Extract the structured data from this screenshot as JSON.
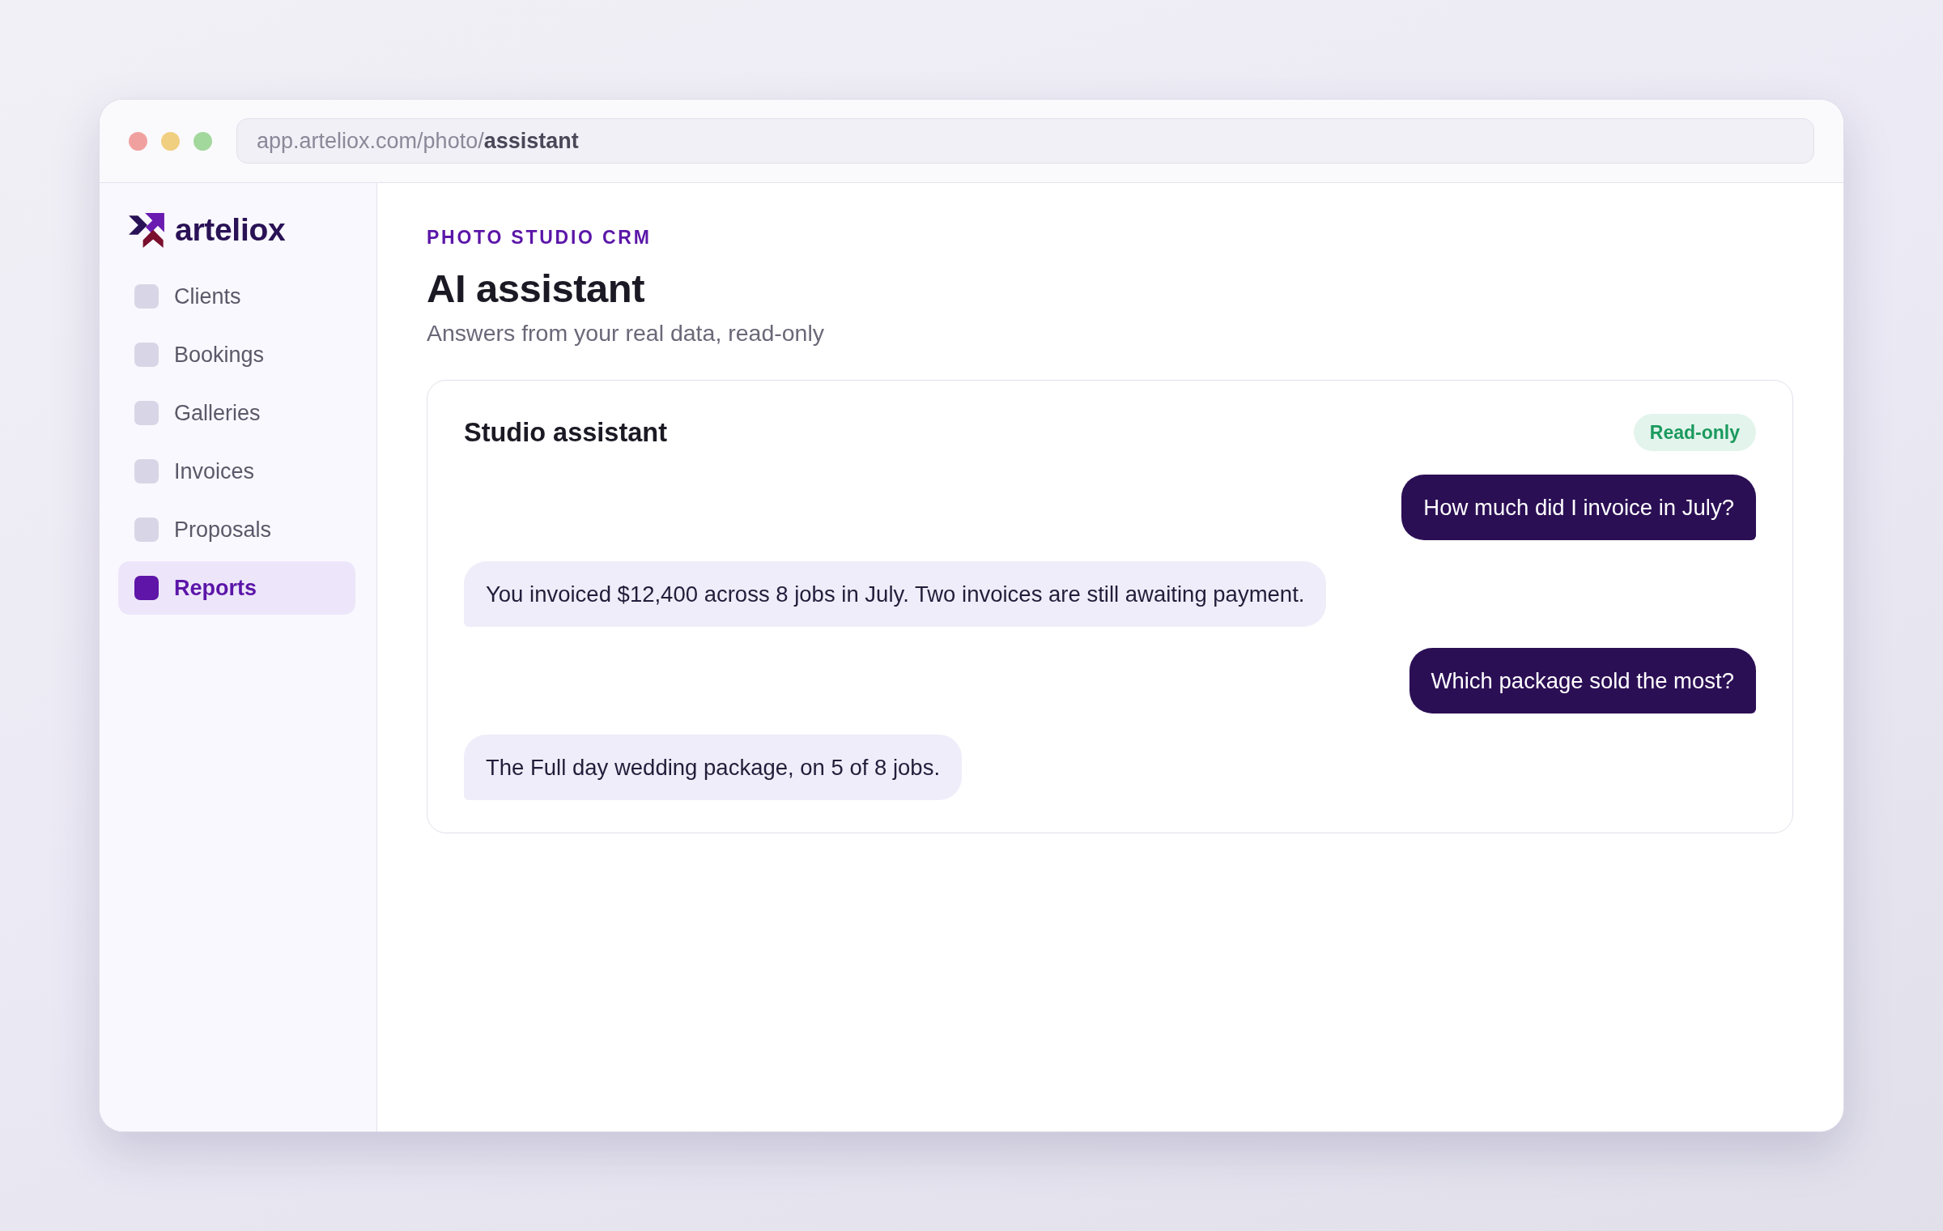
{
  "browser": {
    "url": "app.arteliox.com/photo/**assistant**"
  },
  "sidebar": {
    "brand": "arteliox",
    "items": [
      {
        "label": "Clients",
        "selected": false
      },
      {
        "label": "Bookings",
        "selected": false
      },
      {
        "label": "Galleries",
        "selected": false
      },
      {
        "label": "Invoices",
        "selected": false
      },
      {
        "label": "Proposals",
        "selected": false
      },
      {
        "label": "Reports",
        "selected": true
      }
    ]
  },
  "header": {
    "eyebrow": "PHOTO STUDIO CRM",
    "title": "AI assistant",
    "subtitle": "Answers from your real data, read-only"
  },
  "chat": {
    "title": "Studio assistant",
    "badge": "Read-only",
    "messages": [
      {
        "kind": "user",
        "text": "How much did I invoice in July?"
      },
      {
        "kind": "assistant",
        "text": "You invoiced $12,400 across 8 jobs in July. Two invoices are still awaiting payment."
      },
      {
        "kind": "user",
        "text": "Which package sold the most?"
      },
      {
        "kind": "assistant",
        "text": "The Full day wedding package, on 5 of 8 jobs."
      }
    ]
  }
}
